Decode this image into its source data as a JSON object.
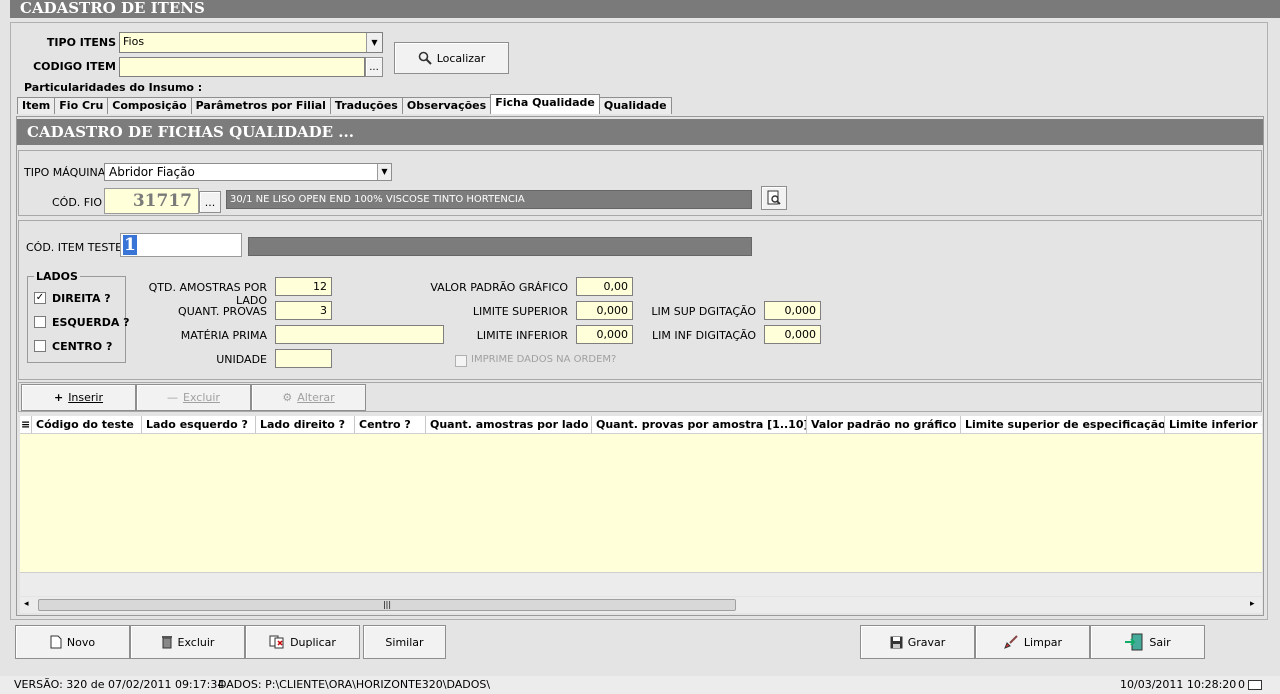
{
  "window": {
    "title": "CADASTRO DE ITENS"
  },
  "header": {
    "tipo_itens_label": "TIPO ITENS",
    "tipo_itens_value": "Fios",
    "codigo_item_label": "CODIGO ITEM",
    "codigo_item_value": "",
    "ellipsis": "...",
    "localizar_label": "Localizar"
  },
  "group_label": "Particularidades do Insumo :",
  "tabs": [
    {
      "label": "Item"
    },
    {
      "label": "Fio Cru"
    },
    {
      "label": "Composição"
    },
    {
      "label": "Parâmetros por Filial"
    },
    {
      "label": "Traduções"
    },
    {
      "label": "Observações"
    },
    {
      "label": "Ficha Qualidade"
    },
    {
      "label": "Qualidade"
    }
  ],
  "form": {
    "title": "CADASTRO DE FICHAS QUALIDADE ...",
    "tipo_maquina_label": "TIPO MÁQUINA",
    "tipo_maquina_value": "Abridor Fiação",
    "cod_fio_label": "CÓD. FIO",
    "cod_fio_value": "31717",
    "cod_fio_desc": "30/1 NE  LISO  OPEN END  100% VISCOSE  TINTO HORTENCIA",
    "cod_item_teste_label": "CÓD. ITEM TESTE",
    "cod_item_teste_value": "1",
    "lados_label": "LADOS",
    "direita_label": "DIREITA ?",
    "esquerda_label": "ESQUERDA ?",
    "centro_label": "CENTRO ?",
    "qtd_amostras_label": "QTD. AMOSTRAS POR LADO",
    "qtd_amostras_value": "12",
    "quant_provas_label": "QUANT. PROVAS",
    "quant_provas_value": "3",
    "materia_prima_label": "MATÉRIA PRIMA",
    "materia_prima_value": "",
    "unidade_label": "UNIDADE",
    "unidade_value": "",
    "valor_padrao_label": "VALOR PADRÃO GRÁFICO",
    "valor_padrao_value": "0,00",
    "limite_superior_label": "LIMITE SUPERIOR",
    "limite_superior_value": "0,000",
    "limite_inferior_label": "LIMITE INFERIOR",
    "limite_inferior_value": "0,000",
    "lim_sup_dig_label": "LIM SUP DGITAÇÃO",
    "lim_sup_dig_value": "0,000",
    "lim_inf_dig_label": "LIM INF DIGITAÇÃO",
    "lim_inf_dig_value": "0,000",
    "imprime_label": "IMPRIME DADOS NA ORDEM?"
  },
  "grid_toolbar": {
    "inserir": "Inserir",
    "excluir": "Excluir",
    "alterar": "Alterar"
  },
  "grid": {
    "columns": [
      "Código do teste",
      "Lado esquerdo ?",
      "Lado direito ?",
      "Centro ?",
      "Quant. amostras por lado",
      "Quant. provas por amostra [1..10]",
      "Valor padrão no gráfico",
      "Limite superior de especificação",
      "Limite inferior de"
    ]
  },
  "bottom_buttons": {
    "novo": "Novo",
    "excluir": "Excluir",
    "duplicar": "Duplicar",
    "similar": "Similar",
    "gravar": "Gravar",
    "limpar": "Limpar",
    "sair": "Sair"
  },
  "status": {
    "versao": "VERSÃO: 320 de 07/02/2011 09:17:34",
    "dados": "DADOS: P:\\CLIENTE\\ORA\\HORIZONTE320\\DADOS\\",
    "datetime": "10/03/2011 10:28:20",
    "count": "0"
  }
}
